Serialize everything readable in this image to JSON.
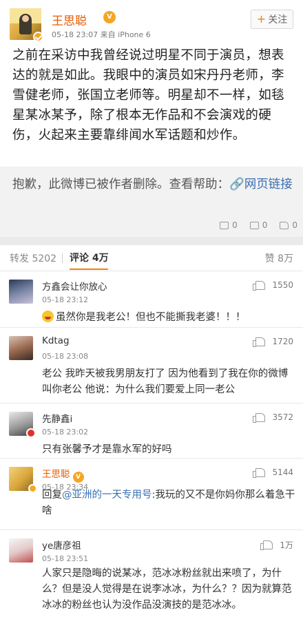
{
  "post": {
    "author": "王思聪",
    "vip_badge": "V",
    "meta": "05-18 23:07  来自 iPhone 6",
    "follow_label": "关注",
    "follow_icon": "plus-icon",
    "text": "之前在采访中我曾经说过明星不同于演员，想表达的就是如此。我眼中的演员如宋丹丹老师，李雪健老师，张国立老师等。明星却不一样，如毯星某冰某予，除了根本无作品和不会演戏的硬伤，火起来主要靠绯闻水军话题和炒作。"
  },
  "forwarded": {
    "text": "抱歉，此微博已被作者删除。查看帮助：",
    "link_icon": "link-icon",
    "link_text": "网页链接",
    "actions": [
      {
        "icon": "repost-icon",
        "count": "0"
      },
      {
        "icon": "comment-icon",
        "count": "0"
      },
      {
        "icon": "like-icon",
        "count": "0"
      }
    ]
  },
  "tabs": {
    "repost": "转发 5202",
    "comment": "评论 4万",
    "likes": "赞 8万"
  },
  "comments": [
    {
      "name": "方鑫会让你放心",
      "time": "05-18 23:12",
      "likes": "1550",
      "text": "虽然你是我老公！但也不能撕我老婆！！！",
      "has_emoji": true
    },
    {
      "name": "Kdtag",
      "time": "05-18 23:08",
      "likes": "1720",
      "text": "老公 我昨天被我男朋友打了 因为他看到了我在你的微博叫你老公 他说：为什么我们要爱上同一老公"
    },
    {
      "name": "先静鑫i",
      "time": "05-18 23:02",
      "likes": "3572",
      "text": "只有张馨予才是靠水军的好吗"
    },
    {
      "name": "王思聪",
      "time": "05-18 23:34",
      "likes": "5144",
      "reply_prefix": "回复",
      "mention": "@亚洲的一天专用号",
      "text": ":我玩的又不是你妈你那么着急干啥"
    },
    {
      "name": "ye唐彦祖",
      "time": "05-18 23:51",
      "likes": "1万",
      "text": "人家只是隐晦的说某冰，范冰冰粉丝就出来喷了，为什么？但是没人觉得是在说李冰冰，为什么？？因为就算范冰冰的粉丝也认为没作品没演技的是范冰冰。"
    }
  ],
  "colors": {
    "accent": "#f08200",
    "author": "#e85b00",
    "link": "#3a6fb0"
  }
}
